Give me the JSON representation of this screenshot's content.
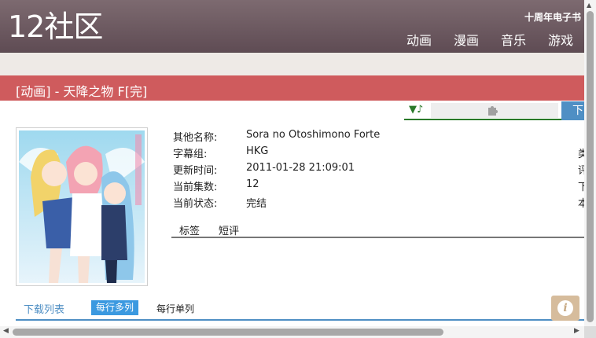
{
  "header": {
    "logo": "12社区",
    "promo": "十周年电子书",
    "nav": [
      "动画",
      "漫画",
      "音乐",
      "游戏"
    ]
  },
  "page": {
    "title": "[动画] - 天降之物 F[完]"
  },
  "toolbar": {
    "music_icon": "▼♪",
    "plugin_icon": "puzzle-icon",
    "download_label": "下"
  },
  "details": {
    "rows": [
      {
        "label": "其他名称:",
        "value": "Sora no Otoshimono Forte"
      },
      {
        "label": "字幕组:",
        "value": "HKG"
      },
      {
        "label": "更新时间:",
        "value": "2011-01-28 21:09:01"
      },
      {
        "label": "当前集数:",
        "value": "12"
      },
      {
        "label": "当前状态:",
        "value": "完结"
      }
    ],
    "right_cut": [
      "类",
      "评",
      "下",
      "本"
    ]
  },
  "tabs": [
    "标签",
    "短评"
  ],
  "downloads": {
    "title": "下载列表",
    "mode_multi": "每行多列",
    "mode_single": "每行单列"
  },
  "info_button": "i",
  "colors": {
    "header": "#6f5c63",
    "title_bar": "#cf5b5d",
    "accent_blue": "#4f8fc4",
    "active_tab": "#3b99e0"
  }
}
